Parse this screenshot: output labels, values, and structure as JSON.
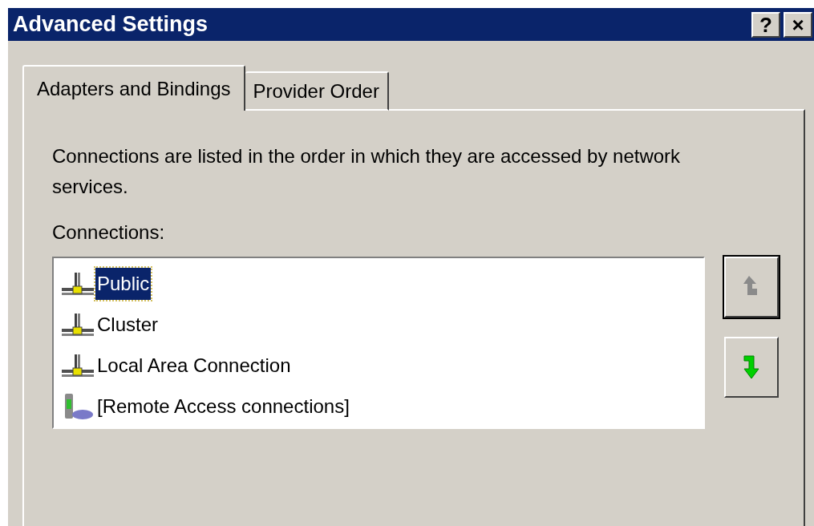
{
  "window": {
    "title": "Advanced Settings",
    "controls": [
      "?",
      "×"
    ]
  },
  "tabs": [
    {
      "label": "Adapters and Bindings",
      "selected": true
    },
    {
      "label": "Provider Order",
      "selected": false
    }
  ],
  "description": "Connections are listed in the order in which they are accessed by network services.",
  "connections": {
    "label": "Connections:",
    "items": [
      {
        "name": "Public",
        "kind": "network",
        "selected": true
      },
      {
        "name": "Cluster",
        "kind": "network",
        "selected": false
      },
      {
        "name": "Local Area Connection",
        "kind": "network",
        "selected": false
      },
      {
        "name": "[Remote Access connections]",
        "kind": "remote",
        "selected": false
      }
    ]
  },
  "move_buttons": [
    {
      "kind": "up",
      "disabled": true
    },
    {
      "kind": "down",
      "disabled": false
    }
  ]
}
